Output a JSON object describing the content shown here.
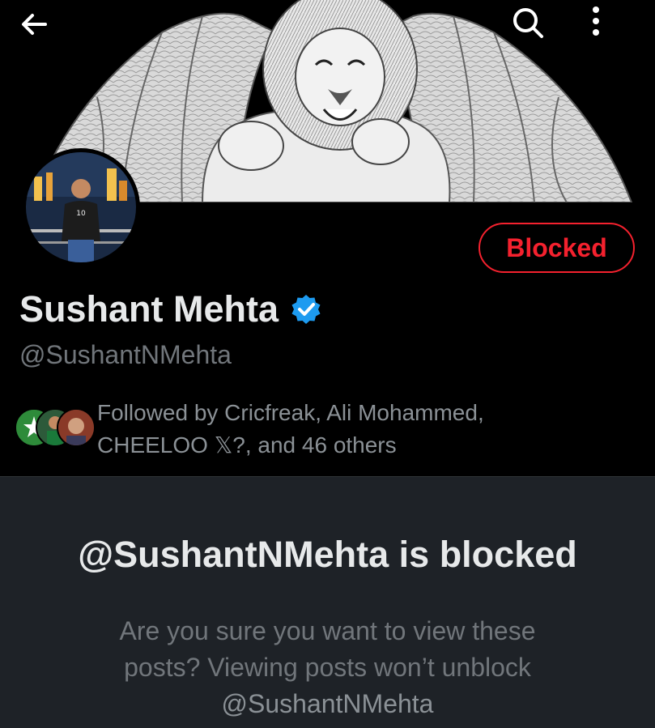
{
  "topbar": {
    "back_icon": "arrow-left-icon",
    "search_icon": "search-icon",
    "more_icon": "more-vertical-icon"
  },
  "profile": {
    "display_name": "Sushant Mehta",
    "verified": true,
    "handle": "@SushantNMehta",
    "blocked_button_label": "Blocked",
    "followed_by_line1": "Followed by Cricfreak, Ali Mohammed,",
    "followed_by_line2": "CHEELOO 𝕏?, and 46 others"
  },
  "blocked_notice": {
    "title": "@SushantNMehta is blocked",
    "body_line1": "Are you sure you want to view these",
    "body_line2": "posts? Viewing posts won’t unblock",
    "body_handle": "@SushantNMehta"
  },
  "colors": {
    "background": "#000000",
    "text_primary": "#e7e9ea",
    "text_secondary": "#71767b",
    "blocked_red": "#f4212e",
    "verified_blue": "#1d9bf0",
    "panel_bg": "#1e2227"
  }
}
